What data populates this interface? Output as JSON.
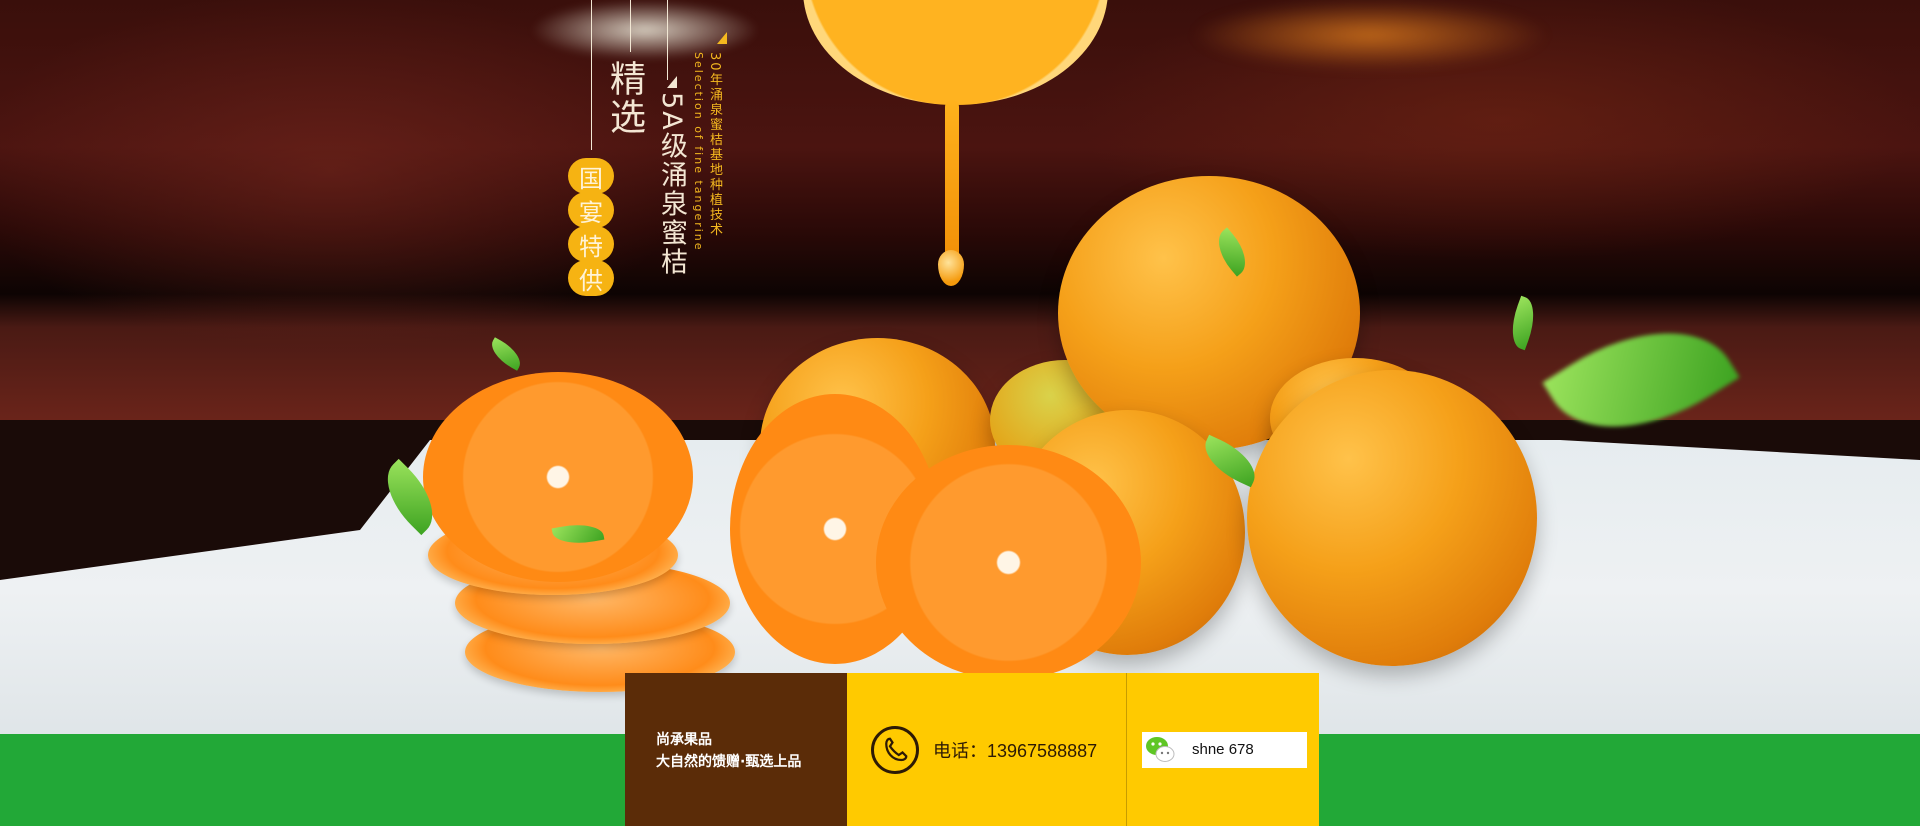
{
  "hero": {
    "title": "精选",
    "badge_chars": [
      "国",
      "宴",
      "特",
      "供"
    ],
    "subtitle": "5A级涌泉蜜桔",
    "small_line": "30年涌泉蜜桔基地种植技术",
    "english_line": "Selection of fine tangerine"
  },
  "footer": {
    "brand_name": "尚承果品",
    "brand_slogan": "大自然的馈赠·甄选上品",
    "phone": "电话：13967588887",
    "wechat": "shne 678"
  },
  "colors": {
    "brand_brown": "#5b2c08",
    "accent_yellow": "#ffca00",
    "footer_green": "#22a837"
  }
}
